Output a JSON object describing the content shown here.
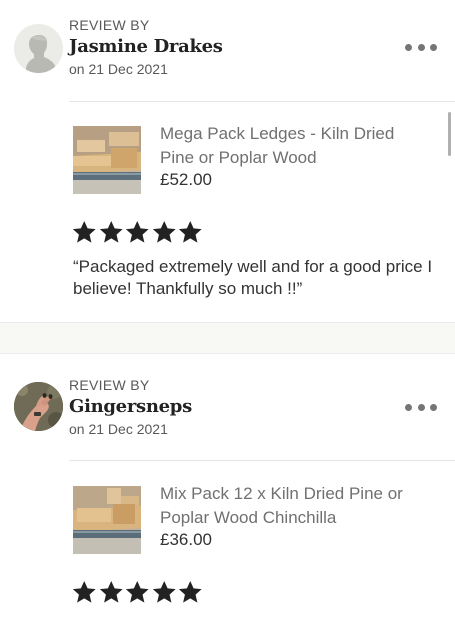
{
  "reviews": [
    {
      "label": "REVIEW BY",
      "name": "Jasmine Drakes",
      "date": "on 21 Dec 2021",
      "rating": 5,
      "product": {
        "title": "Mega Pack Ledges - Kiln Dried Pine or Poplar Wood",
        "price": "£52.00"
      },
      "text": "“Packaged extremely well and for a good price I believe! Thankfully so much !!”"
    },
    {
      "label": "REVIEW BY",
      "name": "Gingersneps",
      "date": "on 21 Dec 2021",
      "rating": 5,
      "product": {
        "title": "Mix Pack 12 x Kiln Dried Pine or Poplar Wood Chinchilla",
        "price": "£36.00"
      }
    }
  ],
  "icons": {
    "more": "more-options-icon",
    "star": "star-icon",
    "avatar_default": "default-avatar-icon"
  },
  "colors": {
    "star": "#222222",
    "secondary_text": "#595959",
    "separator_bg": "#f8f8f5"
  }
}
